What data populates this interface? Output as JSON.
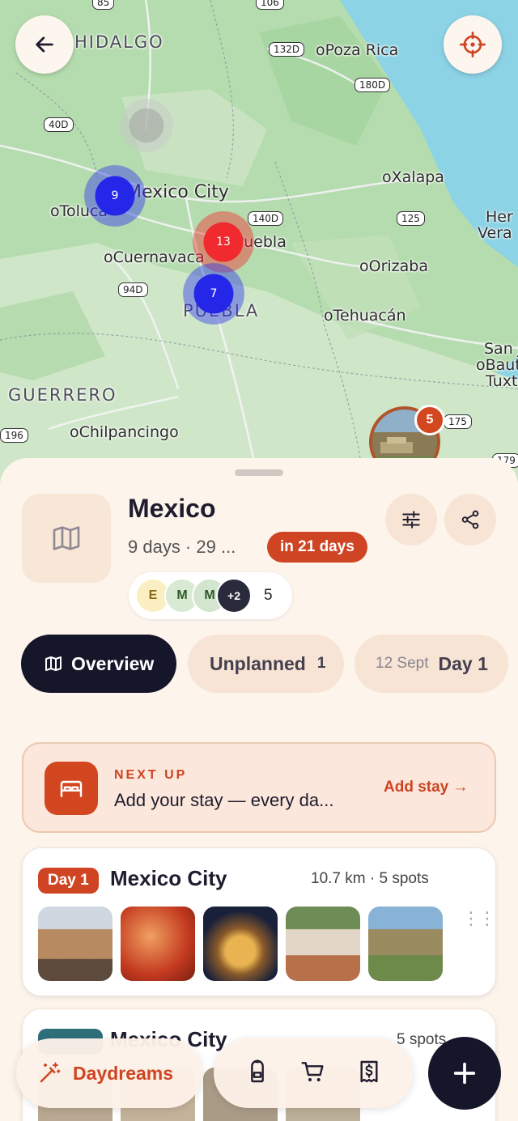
{
  "map": {
    "labels": {
      "hidalgo": "HIDALGO",
      "poza_rica": "oPoza Rica",
      "mexico_city": "Mexico City",
      "toluca": "oToluca",
      "xalapa": "oXalapa",
      "puebla_city": "Puebla",
      "cuernavaca": "oCuernavaca",
      "orizaba": "oOrizaba",
      "puebla_state": "PUEBLA",
      "tehuacan": "oTehuacán",
      "guerrero": "GUERRERO",
      "chilpancingo": "oChilpancingo",
      "veracruz_1": "Her",
      "veracruz_2": "Vera",
      "san": "San J",
      "baut": "oBaut",
      "tuxt": "Tuxte"
    },
    "shields": {
      "s85": "85",
      "s106": "106",
      "s132d": "132D",
      "s180d": "180D",
      "s40d": "40D",
      "s140d": "140D",
      "s125": "125",
      "s94d": "94D",
      "s196": "196",
      "s175": "175",
      "s179": "179"
    },
    "clusters": {
      "mexico_city": "9",
      "puebla": "13",
      "puebla_south": "7"
    },
    "photo_pin_count": "5"
  },
  "trip": {
    "title": "Mexico",
    "meta": "9 days · 29 ...",
    "countdown": "in 21 days",
    "members": {
      "avatars": [
        "E",
        "M",
        "M"
      ],
      "overflow": "+2",
      "count": "5"
    }
  },
  "tabs": {
    "overview": "Overview",
    "unplanned": "Unplanned",
    "unplanned_count": "1",
    "day_date": "12 Sept",
    "day_label": "Day 1"
  },
  "next_up": {
    "kicker": "NEXT UP",
    "text": "Add your stay — every da...",
    "action": "Add stay →"
  },
  "days": [
    {
      "badge": "Day 1",
      "title": "Mexico City",
      "meta": "10.7 km · 5 spots"
    },
    {
      "badge": "",
      "title": "Mexico City",
      "meta": "5 spots"
    }
  ],
  "bottom_bar": {
    "daydreams": "Daydreams"
  },
  "colors": {
    "accent": "#cf4423",
    "dark": "#16162b",
    "sheet_bg": "#fdf4ec",
    "cluster_blue": "#2427e8",
    "cluster_red": "#f02a2e"
  }
}
